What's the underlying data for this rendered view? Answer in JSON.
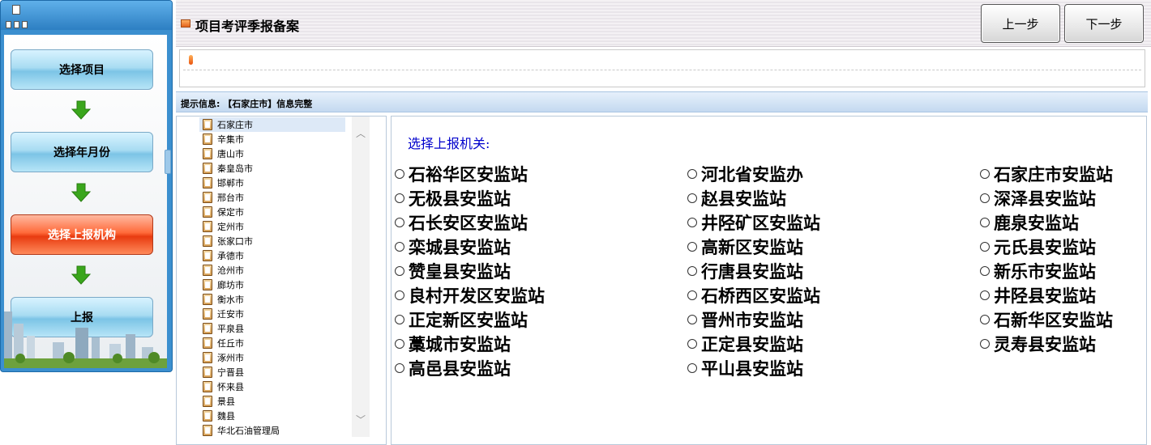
{
  "steps": [
    {
      "label": "选择项目",
      "active": false
    },
    {
      "label": "选择年月份",
      "active": false
    },
    {
      "label": "选择上报机构",
      "active": true
    },
    {
      "label": "上报",
      "active": false
    }
  ],
  "header": {
    "title": "项目考评季报备案",
    "prev_label": "上一步",
    "next_label": "下一步"
  },
  "hint": "提示信息: 【石家庄市】信息完整",
  "tree": {
    "selected": "石家庄市",
    "items": [
      "石家庄市",
      "辛集市",
      "唐山市",
      "秦皇岛市",
      "邯郸市",
      "邢台市",
      "保定市",
      "定州市",
      "张家口市",
      "承德市",
      "沧州市",
      "廊坊市",
      "衡水市",
      "迁安市",
      "平泉县",
      "任丘市",
      "涿州市",
      "宁晋县",
      "怀来县",
      "景县",
      "魏县",
      "华北石油管理局"
    ]
  },
  "main": {
    "label": "选择上报机关:",
    "columns": [
      [
        "石裕华区安监站",
        "无极县安监站",
        "石长安区安监站",
        "栾城县安监站",
        "赞皇县安监站",
        "良村开发区安监站",
        "正定新区安监站",
        "藁城市安监站",
        "高邑县安监站"
      ],
      [
        "河北省安监办",
        "赵县安监站",
        "井陉矿区安监站",
        "高新区安监站",
        "行唐县安监站",
        "石桥西区安监站",
        "晋州市安监站",
        "正定县安监站",
        "平山县安监站"
      ],
      [
        "石家庄市安监站",
        "深泽县安监站",
        "鹿泉安监站",
        "元氏县安监站",
        "新乐市安监站",
        "井陉县安监站",
        "石新华区安监站",
        "灵寿县安监站"
      ]
    ]
  },
  "icons": {
    "step_arrow": "down-arrow-icon",
    "tree_node": "clipboard-icon",
    "title": "window-icon"
  },
  "colors": {
    "active_step": "#ff5a25",
    "label_blue": "#0000cc",
    "arrow_green": "#3aa61c"
  }
}
